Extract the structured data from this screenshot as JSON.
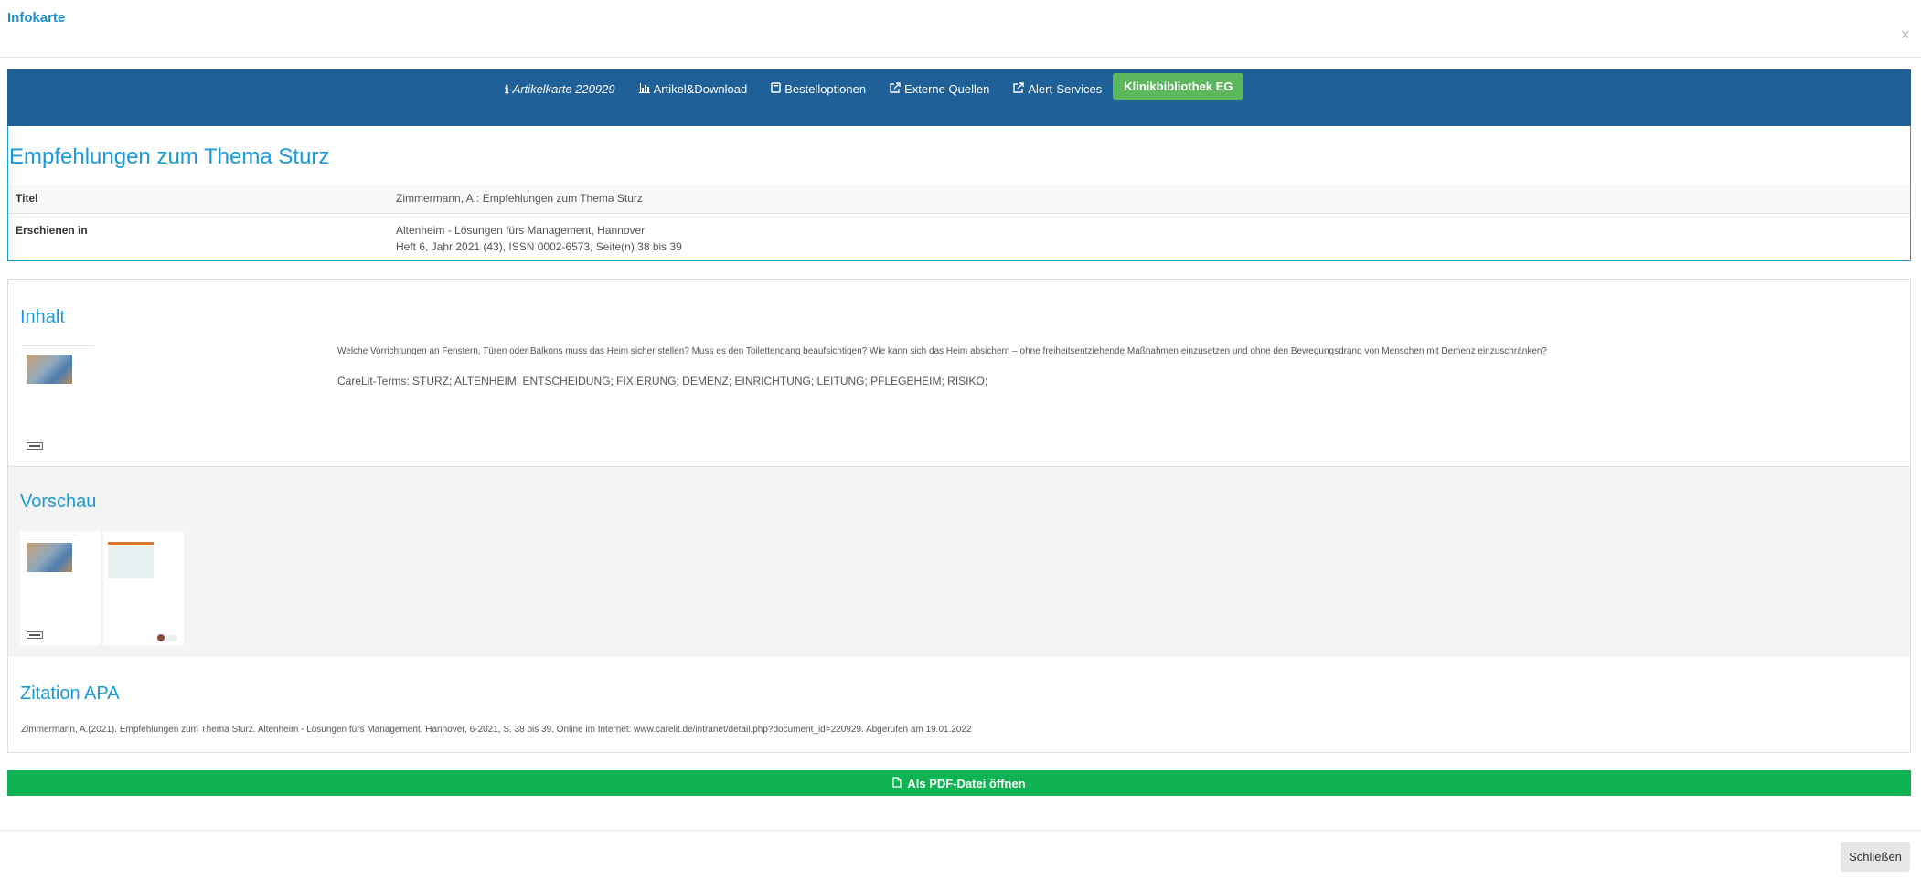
{
  "modal": {
    "title": "Infokarte",
    "close_symbol": "×"
  },
  "nav": {
    "items": [
      {
        "icon": "info-icon",
        "label": "Artikelkarte 220929"
      },
      {
        "icon": "bar-chart-icon",
        "label": "Artikel&Download"
      },
      {
        "icon": "book-icon",
        "label": "Bestelloptionen"
      },
      {
        "icon": "external-link-icon",
        "label": "Externe Quellen"
      },
      {
        "icon": "external-link-icon",
        "label": "Alert-Services"
      }
    ],
    "badge": "Klinikbibliothek EG"
  },
  "article": {
    "title": "Empfehlungen zum Thema Sturz",
    "rows": [
      {
        "label": "Titel",
        "value": "Zimmermann, A.: Empfehlungen zum Thema Sturz"
      },
      {
        "label": "Erschienen in",
        "value": "Altenheim - Lösungen fürs Management, Hannover",
        "value2": "Heft 6, Jahr 2021 (43), ISSN 0002-6573, Seite(n) 38 bis 39"
      }
    ]
  },
  "inhalt": {
    "heading": "Inhalt",
    "description": "Welche Vorrichtungen an Fenstern, Türen oder Balkons muss das Heim sicher stellen? Muss es den Toilettengang beaufsichtigen? Wie kann sich das Heim absichern – ohne freiheitsentziehende Maßnahmen einzusetzen und ohne den Bewegungsdrang von Menschen mit Demenz einzuschränken?",
    "terms": "CareLit-Terms: STURZ; ALTENHEIM; ENTSCHEIDUNG; FIXIERUNG; DEMENZ; EINRICHTUNG; LEITUNG; PFLEGEHEIM; RISIKO;"
  },
  "vorschau": {
    "heading": "Vorschau"
  },
  "zitation": {
    "heading": "Zitation APA",
    "text": "Zimmermann, A.(2021). Empfehlungen zum Thema Sturz. Altenheim - Lösungen fürs Management, Hannover, 6-2021, S. 38 bis 39. Online im Internet: www.carelit.de/intranet/detail.php?document_id=220929. Abgerufen am 19.01.2022"
  },
  "footer": {
    "pdf_label": "Als PDF-Datei öffnen",
    "close_label": "Schließen"
  },
  "colors": {
    "brand_blue": "#1f6099",
    "accent_blue": "#1a9bd7",
    "green_badge": "#5cb85c",
    "green_button": "#0fb354"
  }
}
